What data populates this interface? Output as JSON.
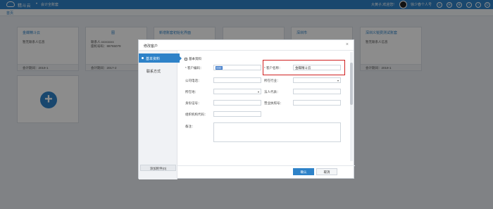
{
  "topbar": {
    "brand": "精斗云",
    "separator": "•",
    "subtitle": "会计全账套",
    "welcome": "大黄子,欢迎您!",
    "user": "徐少春个人号",
    "icons": [
      "user-icon",
      "chat-icon",
      "settings-icon",
      "help-icon",
      "bell-icon",
      "power-icon"
    ]
  },
  "subnav": {
    "crumb": "首页"
  },
  "cards": [
    {
      "title": "金蝶精斗云",
      "line1": "暂无联系人信息",
      "line2": "",
      "foot": "会计期间：2019-1"
    },
    {
      "title": "图",
      "line1": "联系人:xxxxxxxx",
      "line2": "座机号码：88765079",
      "foot": "会计期间：2017-2"
    },
    {
      "title": "新增账套初始化界面",
      "line1": "",
      "line2": "",
      "foot": ""
    },
    {
      "title": "",
      "line1": "",
      "line2": "",
      "foot": ""
    },
    {
      "title": "深圳市",
      "line1": "",
      "line2": "",
      "foot": ""
    },
    {
      "title": "深圳义锐费测试账套",
      "line1": "暂无联系人信息",
      "line2": "",
      "foot": "会计期间：2019-1"
    }
  ],
  "modal": {
    "title": "修改客户",
    "close": "×",
    "tabs": {
      "basic": "基本资料",
      "contact": "联系方式"
    },
    "attach": "添加附件(0)",
    "section": "基本资料",
    "fields": {
      "code_label": "* 客户编码：",
      "code_value": "000",
      "name_label": "* 客户名称：",
      "name_value": "金蝶精斗云",
      "company_phone_label": "公司电话：",
      "industry_label": "所在行业：",
      "region_label": "所在地：",
      "legal_rep_label": "法人代表：",
      "id_label": "身份证号：",
      "license_label": "营业执照号：",
      "org_code_label": "组织机构代码：",
      "remark_label": "备注："
    },
    "ok": "确认",
    "cancel": "取消"
  }
}
